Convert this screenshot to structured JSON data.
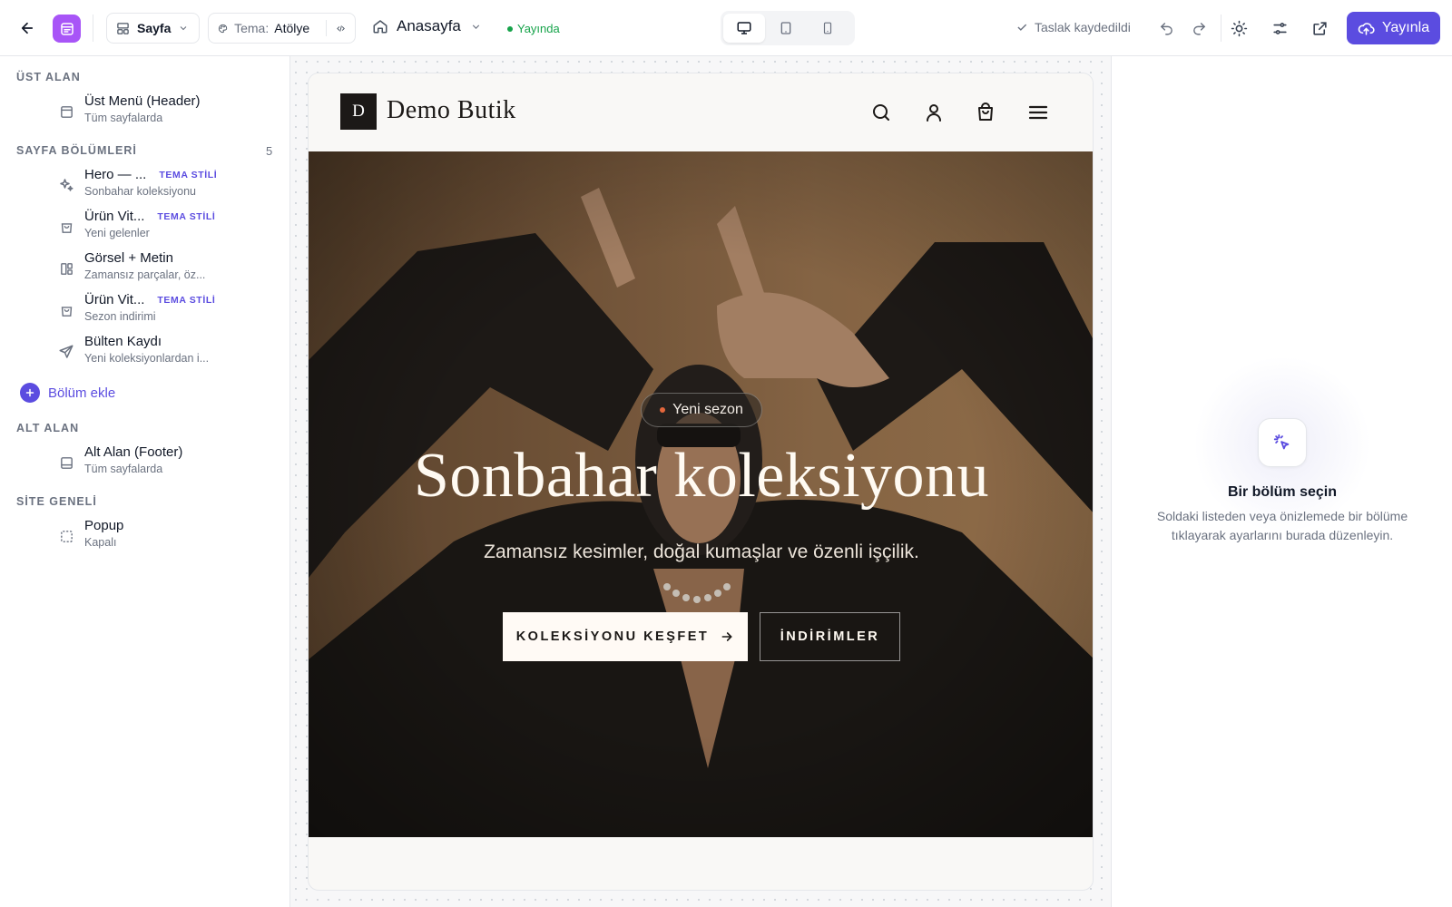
{
  "topbar": {
    "page_button": "Sayfa",
    "theme_label": "Tema:",
    "theme_value": "Atölye",
    "page_name": "Anasayfa",
    "status": "Yayında",
    "saved_text": "Taslak kaydedildi",
    "publish_label": "Yayınla"
  },
  "sidebar": {
    "groups": {
      "top": "ÜST ALAN",
      "sections": "SAYFA BÖLÜMLERİ",
      "sections_count": "5",
      "bottom": "ALT ALAN",
      "site": "SİTE GENELİ"
    },
    "header_item": {
      "title": "Üst Menü (Header)",
      "subtitle": "Tüm sayfalarda"
    },
    "items": [
      {
        "title": "Hero — ...",
        "subtitle": "Sonbahar koleksiyonu",
        "badge": "TEMA STİLİ",
        "icon": "sparkles-icon"
      },
      {
        "title": "Ürün Vit...",
        "subtitle": "Yeni gelenler",
        "badge": "TEMA STİLİ",
        "icon": "shopping-bag-icon"
      },
      {
        "title": "Görsel + Metin",
        "subtitle": "Zamansız parçalar, öz...",
        "badge": "",
        "icon": "layout-icon"
      },
      {
        "title": "Ürün Vit...",
        "subtitle": "Sezon indirimi",
        "badge": "TEMA STİLİ",
        "icon": "shopping-bag-icon"
      },
      {
        "title": "Bülten Kaydı",
        "subtitle": "Yeni koleksiyonlardan i...",
        "badge": "",
        "icon": "send-icon"
      }
    ],
    "add_section": "Bölüm ekle",
    "footer_item": {
      "title": "Alt Alan (Footer)",
      "subtitle": "Tüm sayfalarda"
    },
    "popup_item": {
      "title": "Popup",
      "subtitle": "Kapalı"
    }
  },
  "preview": {
    "logo_letter": "D",
    "brand": "Demo Butik",
    "pill": "Yeni sezon",
    "headline": "Sonbahar koleksiyonu",
    "subhead": "Zamansız kesimler, doğal kumaşlar ve özenli işçilik.",
    "cta_primary": "KOLEKSİYONU KEŞFET",
    "cta_secondary": "İNDİRİMLER"
  },
  "inspector": {
    "title": "Bir bölüm seçin",
    "desc_line1": "Soldaki listeden veya önizlemede bir bölüme",
    "desc_line2": "tıklayarak ayarlarını burada düzenleyin."
  },
  "colors": {
    "accent": "#5b4ce0",
    "live": "#16a34a"
  }
}
